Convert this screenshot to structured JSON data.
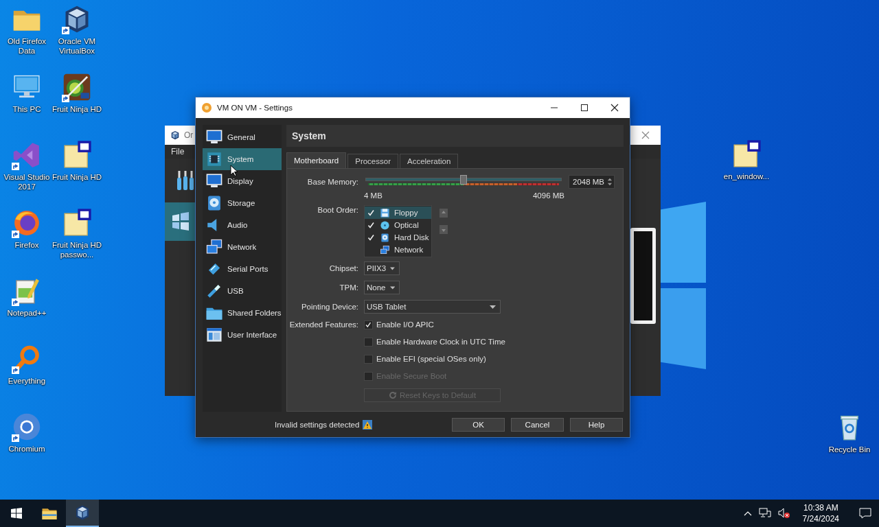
{
  "desktop_icons": [
    {
      "label": "Old Firefox Data",
      "kind": "folder",
      "shortcut": false
    },
    {
      "label": "Oracle VM VirtualBox",
      "kind": "virtualbox",
      "shortcut": true
    },
    {
      "label": "This PC",
      "kind": "this-pc",
      "shortcut": false
    },
    {
      "label": "Fruit Ninja HD",
      "kind": "game",
      "shortcut": true
    },
    {
      "label": "Visual Studio 2017",
      "kind": "visual-studio",
      "shortcut": true
    },
    {
      "label": "Fruit Ninja HD",
      "kind": "tagged-folder",
      "shortcut": false
    },
    {
      "label": "Firefox",
      "kind": "firefox",
      "shortcut": true
    },
    {
      "label": "Fruit Ninja HD passwo...",
      "kind": "tagged-folder",
      "shortcut": false
    },
    {
      "label": "Notepad++",
      "kind": "notepad",
      "shortcut": true
    },
    {
      "label": "Everything",
      "kind": "everything",
      "shortcut": true
    },
    {
      "label": "Chromium",
      "kind": "chromium",
      "shortcut": true
    },
    {
      "label": "en_window...",
      "kind": "tagged-folder",
      "shortcut": false
    },
    {
      "label": "Recycle Bin",
      "kind": "recycle-bin",
      "shortcut": false
    }
  ],
  "background_window": {
    "title": "Or",
    "menu": [
      "File"
    ]
  },
  "settings": {
    "title": "VM ON VM - Settings",
    "sidebar": [
      {
        "label": "General",
        "kind": "monitor",
        "selected": false
      },
      {
        "label": "System",
        "kind": "chip",
        "selected": true
      },
      {
        "label": "Display",
        "kind": "monitor",
        "selected": false
      },
      {
        "label": "Storage",
        "kind": "storage",
        "selected": false
      },
      {
        "label": "Audio",
        "kind": "audio",
        "selected": false
      },
      {
        "label": "Network",
        "kind": "network",
        "selected": false
      },
      {
        "label": "Serial Ports",
        "kind": "serial",
        "selected": false
      },
      {
        "label": "USB",
        "kind": "usb",
        "selected": false
      },
      {
        "label": "Shared Folders",
        "kind": "shared",
        "selected": false
      },
      {
        "label": "User Interface",
        "kind": "ui",
        "selected": false
      }
    ],
    "page_title": "System",
    "tabs": [
      {
        "label": "Motherboard",
        "selected": true
      },
      {
        "label": "Processor",
        "selected": false
      },
      {
        "label": "Acceleration",
        "selected": false
      }
    ],
    "base_memory": {
      "label": "Base Memory:",
      "level": 0.5,
      "min_label": "4 MB",
      "max_label": "4096 MB",
      "value": "2048 MB"
    },
    "boot_order": {
      "label": "Boot Order:",
      "items": [
        {
          "label": "Floppy",
          "kind": "floppy",
          "checked": true,
          "selected": true
        },
        {
          "label": "Optical",
          "kind": "optical",
          "checked": true,
          "selected": false
        },
        {
          "label": "Hard Disk",
          "kind": "harddisk",
          "checked": true,
          "selected": false
        },
        {
          "label": "Network",
          "kind": "network",
          "checked": false,
          "selected": false
        }
      ]
    },
    "chipset": {
      "label": "Chipset:",
      "value": "PIIX3"
    },
    "tpm": {
      "label": "TPM:",
      "value": "None"
    },
    "pointing_device": {
      "label": "Pointing Device:",
      "value": "USB Tablet"
    },
    "extended_features": {
      "label": "Extended Features:",
      "options": [
        {
          "label": "Enable I/O APIC",
          "checked": true,
          "disabled": false
        },
        {
          "label": "Enable Hardware Clock in UTC Time",
          "checked": false,
          "disabled": false
        },
        {
          "label": "Enable EFI (special OSes only)",
          "checked": false,
          "disabled": false
        },
        {
          "label": "Enable Secure Boot",
          "checked": false,
          "disabled": true
        }
      ]
    },
    "reset_keys_button": {
      "label": "Reset Keys to Default",
      "disabled": true
    },
    "status": "Invalid settings detected",
    "buttons": [
      "OK",
      "Cancel",
      "Help"
    ]
  },
  "taskbar": {
    "apps": [
      {
        "kind": "file-explorer",
        "active": false
      },
      {
        "kind": "virtualbox",
        "active": true
      }
    ],
    "time": "10:38 AM",
    "date": "7/24/2024"
  }
}
